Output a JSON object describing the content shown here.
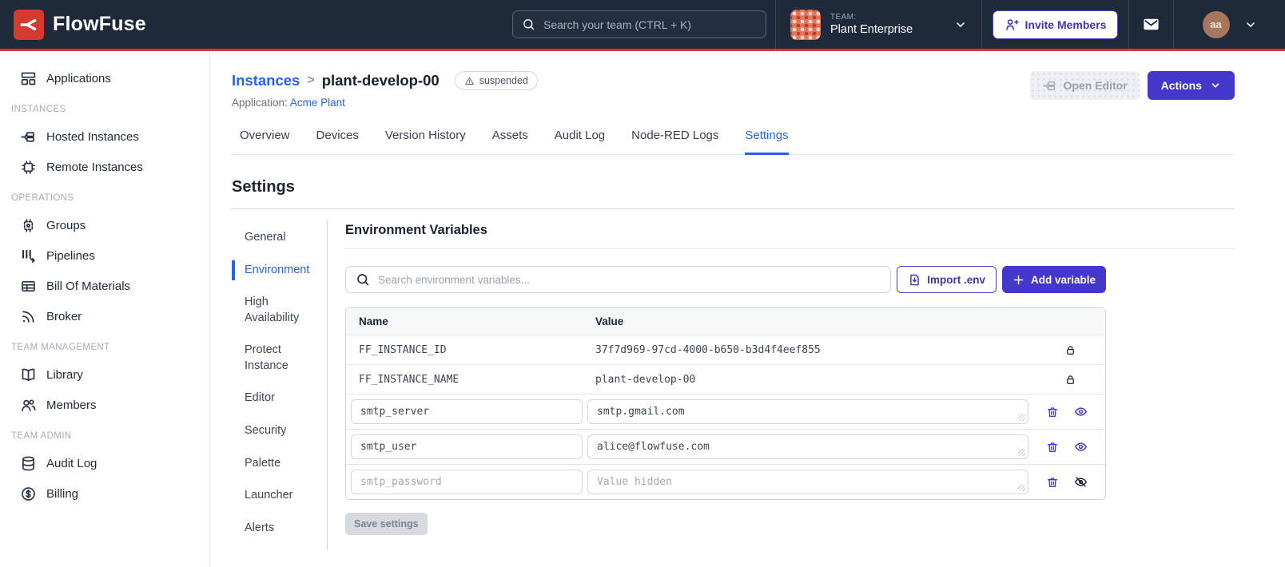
{
  "navbar": {
    "brand": "FlowFuse",
    "search_placeholder": "Search your team (CTRL + K)",
    "team_label": "TEAM:",
    "team_name": "Plant Enterprise",
    "invite_button": "Invite Members",
    "avatar_initials": "aa"
  },
  "sidebar": {
    "applications": "Applications",
    "sections": [
      {
        "title": "INSTANCES",
        "items": [
          {
            "label": "Hosted Instances"
          },
          {
            "label": "Remote Instances"
          }
        ]
      },
      {
        "title": "OPERATIONS",
        "items": [
          {
            "label": "Groups"
          },
          {
            "label": "Pipelines"
          },
          {
            "label": "Bill Of Materials"
          },
          {
            "label": "Broker"
          }
        ]
      },
      {
        "title": "TEAM MANAGEMENT",
        "items": [
          {
            "label": "Library"
          },
          {
            "label": "Members"
          }
        ]
      },
      {
        "title": "TEAM ADMIN",
        "items": [
          {
            "label": "Audit Log"
          },
          {
            "label": "Billing"
          }
        ]
      }
    ]
  },
  "header": {
    "breadcrumb_root": "Instances",
    "breadcrumb_sep": ">",
    "breadcrumb_current": "plant-develop-00",
    "status_badge": "suspended",
    "application_label": "Application:",
    "application_name": "Acme Plant",
    "open_editor_button": "Open Editor",
    "actions_button": "Actions"
  },
  "tabs": {
    "items": [
      "Overview",
      "Devices",
      "Version History",
      "Assets",
      "Audit Log",
      "Node-RED Logs",
      "Settings"
    ],
    "active": "Settings"
  },
  "settings": {
    "title": "Settings",
    "nav": [
      "General",
      "Environment",
      "High Availability",
      "Protect Instance",
      "Editor",
      "Security",
      "Palette",
      "Launcher",
      "Alerts"
    ],
    "nav_active": "Environment",
    "env": {
      "heading": "Environment Variables",
      "search_placeholder": "Search environment variables...",
      "import_button": "Import .env",
      "add_button": "Add variable",
      "table_headers": {
        "name": "Name",
        "value": "Value"
      },
      "locked_rows": [
        {
          "name": "FF_INSTANCE_ID",
          "value": "37f7d969-97cd-4000-b650-b3d4f4eef855"
        },
        {
          "name": "FF_INSTANCE_NAME",
          "value": "plant-develop-00"
        }
      ],
      "rows": [
        {
          "name": "smtp_server",
          "value": "smtp.gmail.com"
        },
        {
          "name": "smtp_user",
          "value": "alice@flowfuse.com"
        },
        {
          "name": "smtp_password",
          "value": "",
          "value_placeholder": "Value hidden"
        }
      ],
      "save_button": "Save settings"
    }
  },
  "colors": {
    "navbar_bg": "#1e2a3a",
    "brand_red": "#d63a2f",
    "accent_indigo": "#4338ca",
    "link_blue": "#2563eb"
  }
}
